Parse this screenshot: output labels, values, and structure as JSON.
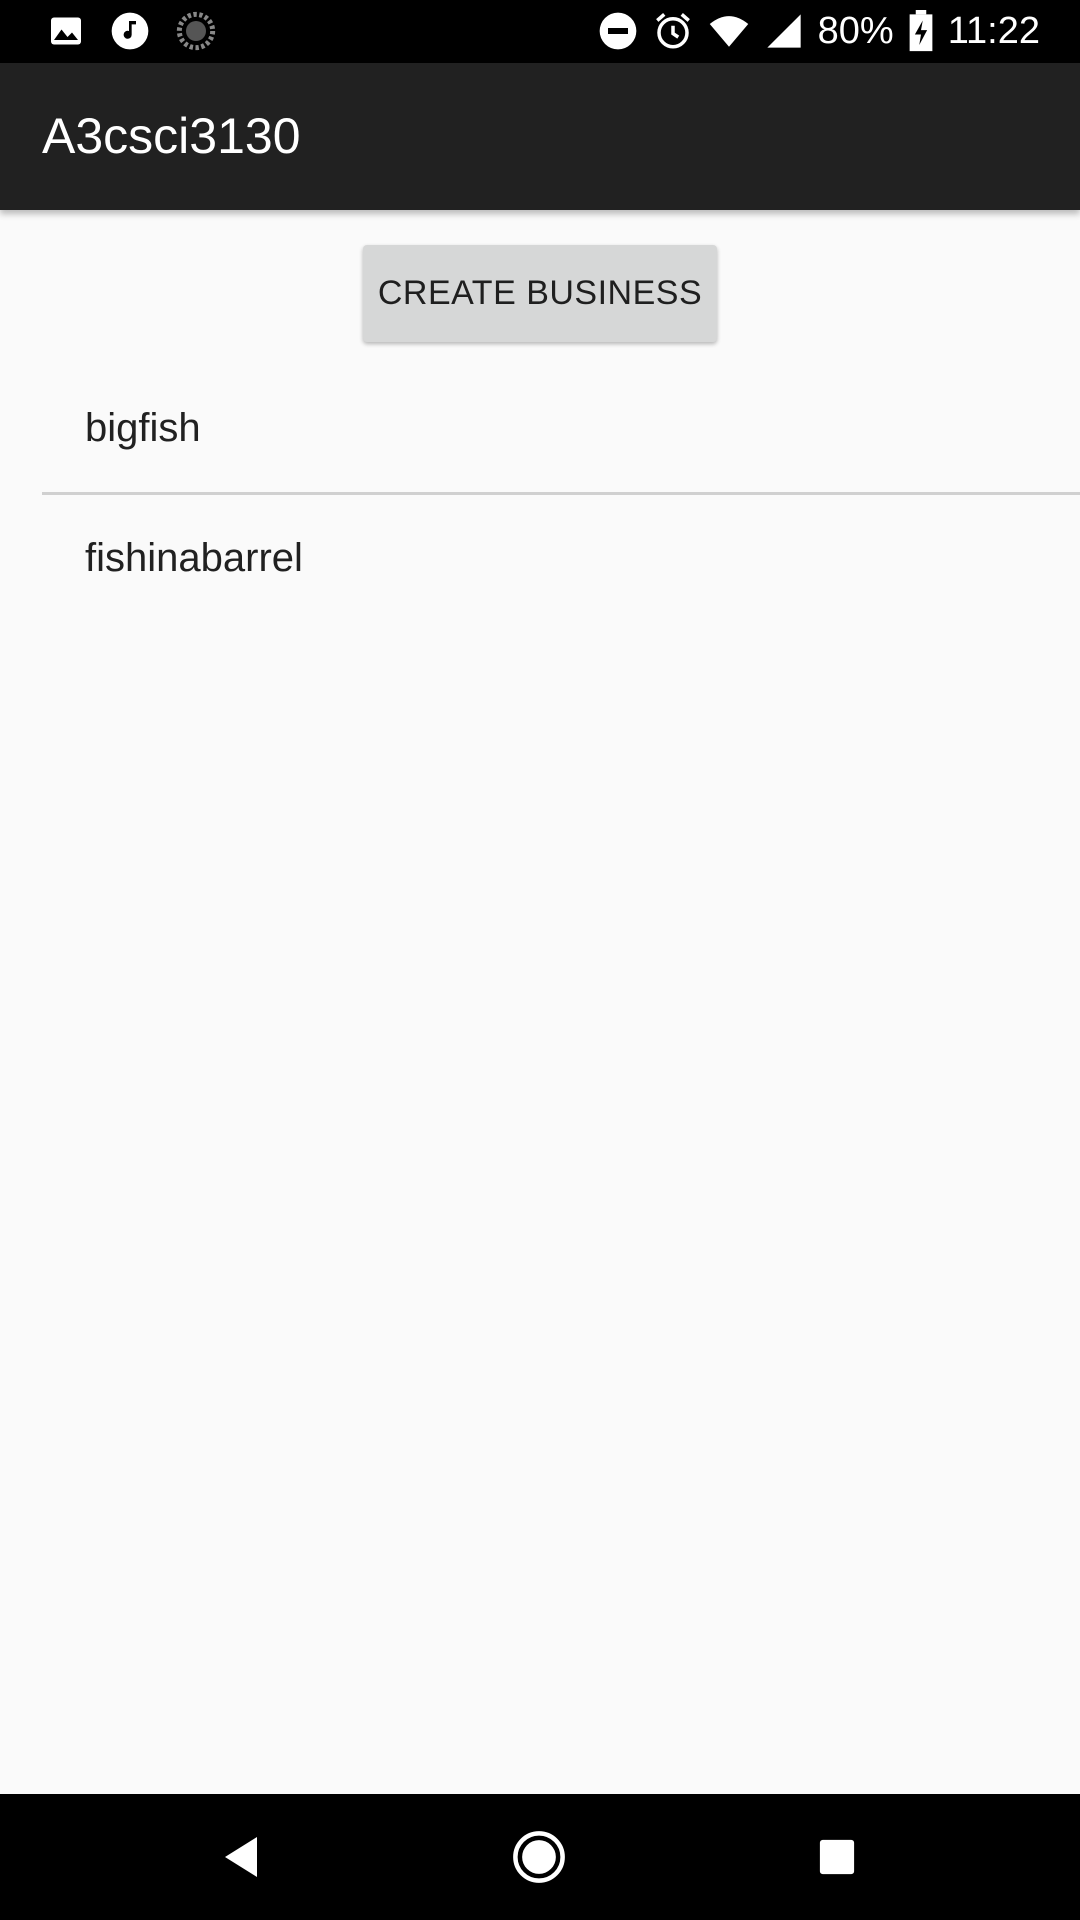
{
  "status_bar": {
    "battery": "80%",
    "time": "11:22",
    "left_icons": [
      "image-icon",
      "music-icon",
      "loading-icon"
    ],
    "right_icons": [
      "do-not-disturb-icon",
      "alarm-icon",
      "wifi-icon",
      "cell-signal-icon",
      "battery-charging-icon"
    ]
  },
  "app_bar": {
    "title": "A3csci3130"
  },
  "main": {
    "create_button_label": "CREATE BUSINESS",
    "businesses": [
      {
        "name": "bigfish"
      },
      {
        "name": "fishinabarrel"
      }
    ]
  },
  "nav_bar": {
    "icons": [
      "back-icon",
      "home-icon",
      "recents-icon"
    ]
  },
  "colors": {
    "status_bar": "#000000",
    "app_bar": "#212121",
    "background": "#fafafa",
    "button": "#d6d7d7",
    "nav_bar": "#000000"
  }
}
